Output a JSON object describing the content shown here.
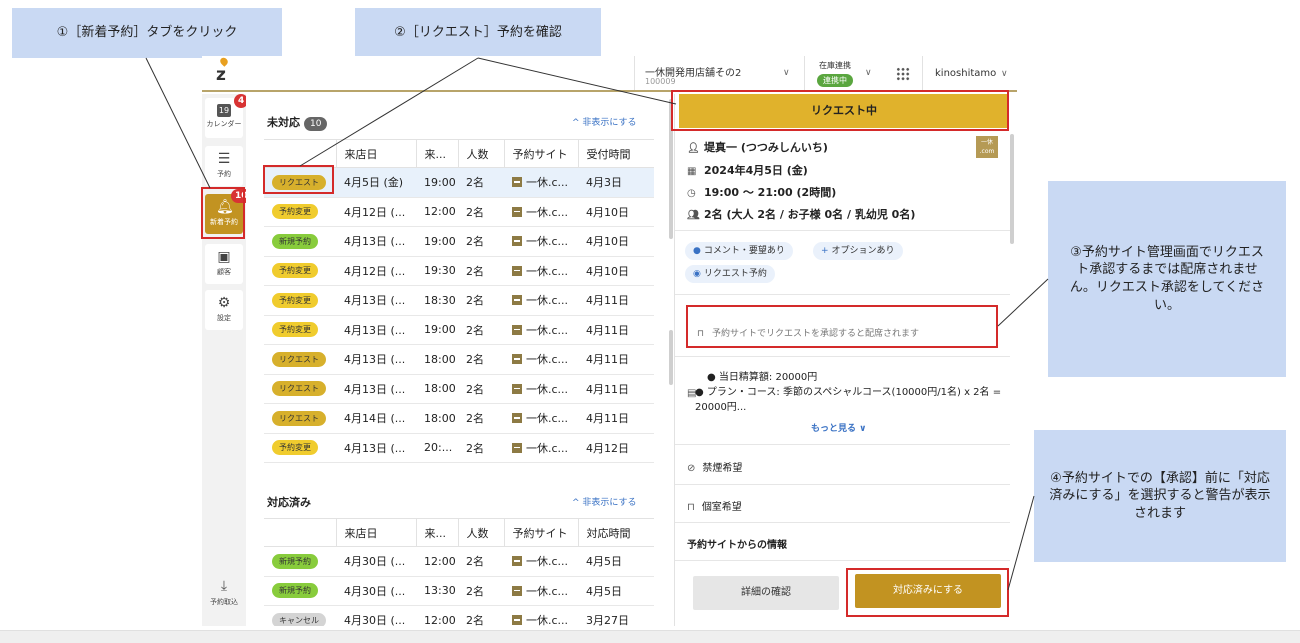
{
  "annotations": {
    "step1": "①［新着予約］タブをクリック",
    "step2": "②［リクエスト］予約を確認",
    "step3": "③予約サイト管理画面でリクエスト承認するまでは配席されません。リクエスト承認をしてください。",
    "step4": "④予約サイトでの【承認】前に「対応済みにする」を選択すると警告が表示されます"
  },
  "header": {
    "logo": "z",
    "store_name": "一休開発用店舗その2",
    "store_code": "100009",
    "stock_label": "在庫連携",
    "stock_badge": "連携中",
    "user": "kinoshitamo"
  },
  "sidebar": {
    "calendar": {
      "label": "カレンダー",
      "day": "19",
      "badge": "4"
    },
    "reservations": {
      "label": "予約"
    },
    "new_reservations": {
      "label": "新着予約",
      "badge": "10"
    },
    "customers": {
      "label": "顧客"
    },
    "settings": {
      "label": "設定"
    },
    "import": {
      "label": "予約取込"
    }
  },
  "pending": {
    "title": "未対応",
    "count": "10",
    "hide_label": "^ 非表示にする",
    "columns": [
      "来店日",
      "来...",
      "人数",
      "予約サイト",
      "受付時間"
    ],
    "rows": [
      {
        "status": "リクエスト",
        "date": "4月5日 (金)",
        "time": "19:00",
        "people": "2名",
        "site": "一休.c...",
        "received": "4月3日"
      },
      {
        "status": "予約変更",
        "date": "4月12日 (...",
        "time": "12:00",
        "people": "2名",
        "site": "一休.c...",
        "received": "4月10日"
      },
      {
        "status": "新規予約",
        "date": "4月13日 (...",
        "time": "19:00",
        "people": "2名",
        "site": "一休.c...",
        "received": "4月10日"
      },
      {
        "status": "予約変更",
        "date": "4月12日 (...",
        "time": "19:30",
        "people": "2名",
        "site": "一休.c...",
        "received": "4月10日"
      },
      {
        "status": "予約変更",
        "date": "4月13日 (...",
        "time": "18:30",
        "people": "2名",
        "site": "一休.c...",
        "received": "4月11日"
      },
      {
        "status": "予約変更",
        "date": "4月13日 (...",
        "time": "19:00",
        "people": "2名",
        "site": "一休.c...",
        "received": "4月11日"
      },
      {
        "status": "リクエスト",
        "date": "4月13日 (...",
        "time": "18:00",
        "people": "2名",
        "site": "一休.c...",
        "received": "4月11日"
      },
      {
        "status": "リクエスト",
        "date": "4月13日 (...",
        "time": "18:00",
        "people": "2名",
        "site": "一休.c...",
        "received": "4月11日"
      },
      {
        "status": "リクエスト",
        "date": "4月14日 (...",
        "time": "18:00",
        "people": "2名",
        "site": "一休.c...",
        "received": "4月11日"
      },
      {
        "status": "予約変更",
        "date": "4月13日 (...",
        "time": "20:...",
        "people": "2名",
        "site": "一休.c...",
        "received": "4月12日"
      }
    ]
  },
  "done": {
    "title": "対応済み",
    "hide_label": "^ 非表示にする",
    "columns": [
      "来店日",
      "来...",
      "人数",
      "予約サイト",
      "対応時間"
    ],
    "rows": [
      {
        "status": "新規予約",
        "date": "4月30日 (...",
        "time": "12:00",
        "people": "2名",
        "site": "一休.c...",
        "received": "4月5日"
      },
      {
        "status": "新規予約",
        "date": "4月30日 (...",
        "time": "13:30",
        "people": "2名",
        "site": "一休.c...",
        "received": "4月5日"
      },
      {
        "status": "キャンセル",
        "date": "4月30日 (...",
        "time": "12:00",
        "people": "2名",
        "site": "一休.c...",
        "received": "3月27日"
      }
    ]
  },
  "detail": {
    "status": "リクエスト中",
    "name": "堤真一 (つつみしんいち)",
    "site_logo_top": "一休",
    "site_logo_bottom": ".com",
    "date": "2024年4月5日 (金)",
    "time": "19:00 〜 21:00 (2時間)",
    "party": "2名 (大人 2名 / お子様 0名 / 乳幼児 0名)",
    "tag_comment": "コメント・要望あり",
    "tag_option": "オプションあり",
    "tag_request": "リクエスト予約",
    "notice": "予約サイトでリクエストを承認すると配席されます",
    "bullet1": "当日精算額: 20000円",
    "bullet2": "プラン・コース: 季節のスペシャルコース(10000円/1名) x 2名 = 20000円...",
    "more": "もっと見る",
    "no_smoking": "禁煙希望",
    "private_room": "個室希望",
    "site_info": "予約サイトからの情報",
    "btn_details": "詳細の確認",
    "btn_done": "対応済みにする"
  },
  "colors": {
    "gold": "#c29321",
    "request_bar": "#e0b22c",
    "annotation_bg": "#c9d9f3",
    "highlight_red": "#d42a2a"
  }
}
